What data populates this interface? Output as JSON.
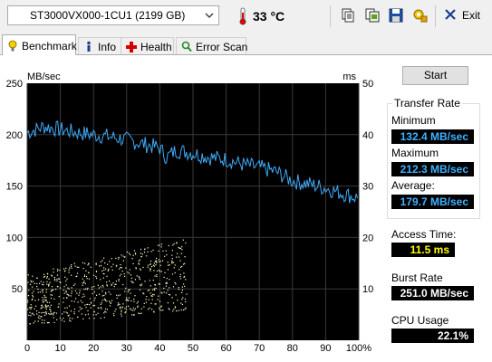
{
  "toolbar": {
    "drive": "ST3000VX000-1CU1 (2199 GB)",
    "temperature": "33 °C",
    "exit_label": "Exit"
  },
  "tabs": [
    {
      "label": "Benchmark",
      "icon": "benchmark-icon",
      "active": true
    },
    {
      "label": "Info",
      "icon": "info-icon",
      "active": false
    },
    {
      "label": "Health",
      "icon": "health-cross-icon",
      "active": false
    },
    {
      "label": "Error Scan",
      "icon": "error-scan-icon",
      "active": false
    }
  ],
  "start_label": "Start",
  "stats": {
    "transfer_rate_title": "Transfer Rate",
    "minimum_label": "Minimum",
    "minimum_value": "132.4 MB/sec",
    "maximum_label": "Maximum",
    "maximum_value": "212.3 MB/sec",
    "average_label": "Average:",
    "average_value": "179.7 MB/sec",
    "access_time_label": "Access Time:",
    "access_time_value": "11.5 ms",
    "burst_rate_label": "Burst Rate",
    "burst_rate_value": "251.0 MB/sec",
    "cpu_usage_label": "CPU Usage",
    "cpu_usage_value": "22.1%"
  },
  "colors": {
    "transfer_line": "#3fa9f5",
    "access_points": "#ffffc0",
    "grid": "#3a3a3a",
    "background": "#000000"
  },
  "chart_data": {
    "type": "line",
    "left_unit": "MB/sec",
    "right_unit": "ms",
    "x_ticks": [
      "0",
      "10",
      "20",
      "30",
      "40",
      "50",
      "60",
      "70",
      "80",
      "90",
      "100%"
    ],
    "y_left_ticks": [
      "250",
      "200",
      "150",
      "100",
      "50"
    ],
    "y_right_ticks": [
      "50",
      "40",
      "30",
      "20",
      "10"
    ],
    "xlim": [
      0,
      100
    ],
    "ylim_left": [
      0,
      250
    ],
    "ylim_right": [
      0,
      50
    ],
    "grid": true,
    "series": [
      {
        "axis": "left",
        "x": [
          0,
          5,
          10,
          15,
          20,
          25,
          30,
          35,
          40,
          42,
          45,
          50,
          55,
          60,
          65,
          70,
          75,
          80,
          85,
          90,
          95,
          100
        ],
        "values": [
          202,
          208,
          205,
          202,
          200,
          198,
          195,
          191,
          187,
          178,
          185,
          182,
          178,
          176,
          171,
          168,
          164,
          155,
          152,
          148,
          143,
          138
        ]
      },
      {
        "axis": "right",
        "type": "scatter",
        "x_range": [
          0,
          48
        ],
        "value_range_start": [
          3,
          13
        ],
        "value_range_end": [
          6,
          20
        ]
      }
    ]
  }
}
